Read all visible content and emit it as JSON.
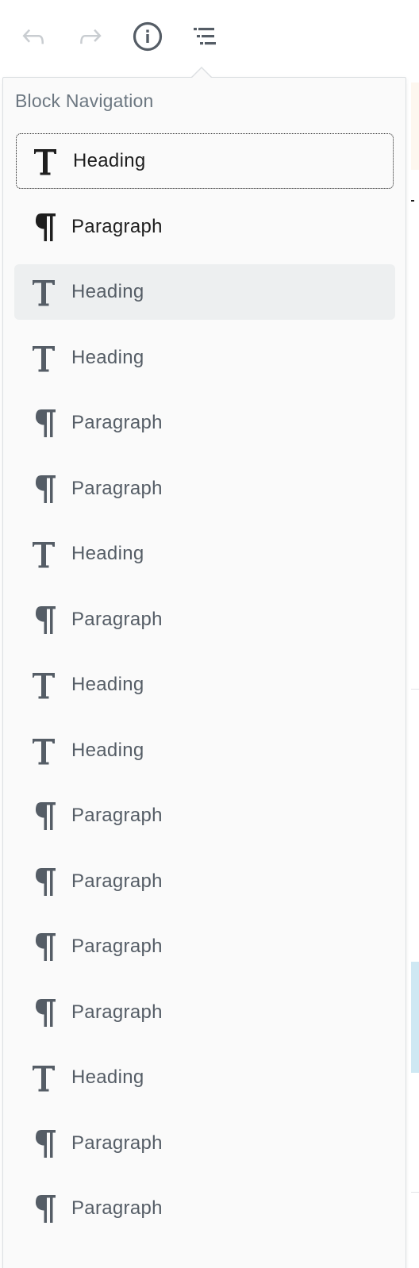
{
  "toolbar": {
    "buttons": [
      {
        "icon": "undo-icon"
      },
      {
        "icon": "redo-icon"
      },
      {
        "icon": "info-icon"
      },
      {
        "icon": "block-navigation-icon"
      }
    ]
  },
  "block_navigation": {
    "title": "Block Navigation",
    "items": [
      {
        "label": "Heading",
        "icon": "heading-icon",
        "state": "focused"
      },
      {
        "label": "Paragraph",
        "icon": "paragraph-icon",
        "state": ""
      },
      {
        "label": "Heading",
        "icon": "heading-icon",
        "state": "selected"
      },
      {
        "label": "Heading",
        "icon": "heading-icon",
        "state": ""
      },
      {
        "label": "Paragraph",
        "icon": "paragraph-icon",
        "state": ""
      },
      {
        "label": "Paragraph",
        "icon": "paragraph-icon",
        "state": ""
      },
      {
        "label": "Heading",
        "icon": "heading-icon",
        "state": ""
      },
      {
        "label": "Paragraph",
        "icon": "paragraph-icon",
        "state": ""
      },
      {
        "label": "Heading",
        "icon": "heading-icon",
        "state": ""
      },
      {
        "label": "Heading",
        "icon": "heading-icon",
        "state": ""
      },
      {
        "label": "Paragraph",
        "icon": "paragraph-icon",
        "state": ""
      },
      {
        "label": "Paragraph",
        "icon": "paragraph-icon",
        "state": ""
      },
      {
        "label": "Paragraph",
        "icon": "paragraph-icon",
        "state": ""
      },
      {
        "label": "Paragraph",
        "icon": "paragraph-icon",
        "state": ""
      },
      {
        "label": "Heading",
        "icon": "heading-icon",
        "state": ""
      },
      {
        "label": "Paragraph",
        "icon": "paragraph-icon",
        "state": ""
      },
      {
        "label": "Paragraph",
        "icon": "paragraph-icon",
        "state": ""
      }
    ]
  },
  "colors": {
    "icon_disabled": "#c9cdd1",
    "icon_active": "#555d66",
    "text": "#555d66",
    "text_dark": "#1e1e1e",
    "selected_bg": "#edeff0",
    "popover_bg": "#fafafa",
    "border": "#dcdfe2"
  }
}
